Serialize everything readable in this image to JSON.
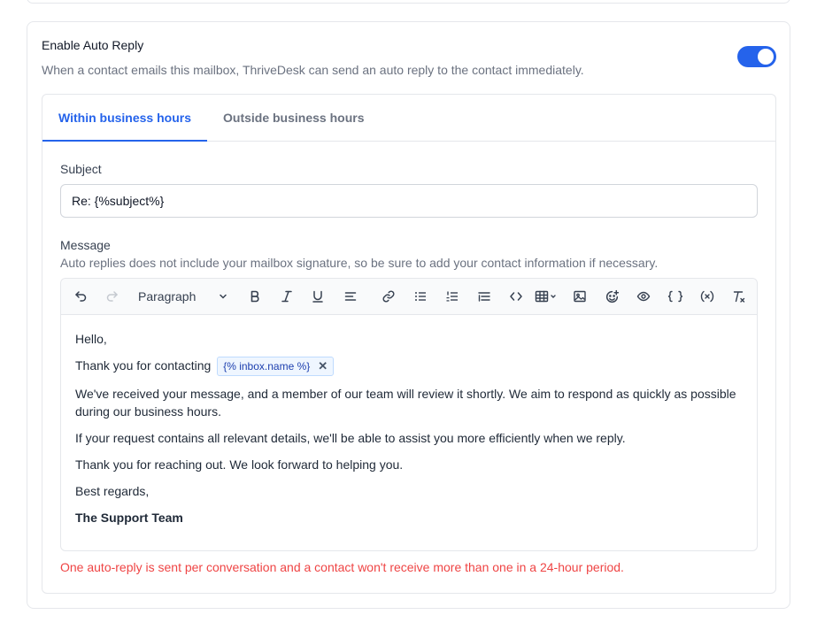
{
  "auto_reply": {
    "title": "Enable Auto Reply",
    "description": "When a contact emails this mailbox, ThriveDesk can send an auto reply to the contact immediately.",
    "enabled": true
  },
  "tabs": [
    {
      "label": "Within business hours",
      "active": true
    },
    {
      "label": "Outside business hours",
      "active": false
    }
  ],
  "subject": {
    "label": "Subject",
    "value": "Re: {%subject%}"
  },
  "message": {
    "label": "Message",
    "help": "Auto replies does not include your mailbox signature, so be sure to add your contact information if necessary."
  },
  "toolbar": {
    "block_format": "Paragraph",
    "icons": [
      "undo-icon",
      "redo-icon",
      "bold-icon",
      "italic-icon",
      "underline-icon",
      "align-icon",
      "link-icon",
      "bullet-list-icon",
      "numbered-list-icon",
      "indent-list-icon",
      "code-icon",
      "table-icon",
      "image-icon",
      "emoji-icon",
      "preview-icon",
      "braces-icon",
      "variable-icon",
      "clear-format-icon"
    ]
  },
  "body": {
    "greeting": "Hello,",
    "thanks_prefix": "Thank you for contacting",
    "variable_chip": "{% inbox.name %}",
    "para1": "We've received your message, and a member of our team will review it shortly. We aim to respond as quickly as possible during our business hours.",
    "para2": "If your request contains all relevant details, we'll be able to assist you more efficiently when we reply.",
    "para3": "Thank you for reaching out. We look forward to helping you.",
    "closing": "Best regards,",
    "signature": "The Support Team"
  },
  "note": "One auto-reply is sent per conversation and a contact won't receive more than one in a 24-hour period.",
  "colors": {
    "accent": "#2563eb",
    "error": "#ef4444",
    "muted": "#6b7280"
  }
}
